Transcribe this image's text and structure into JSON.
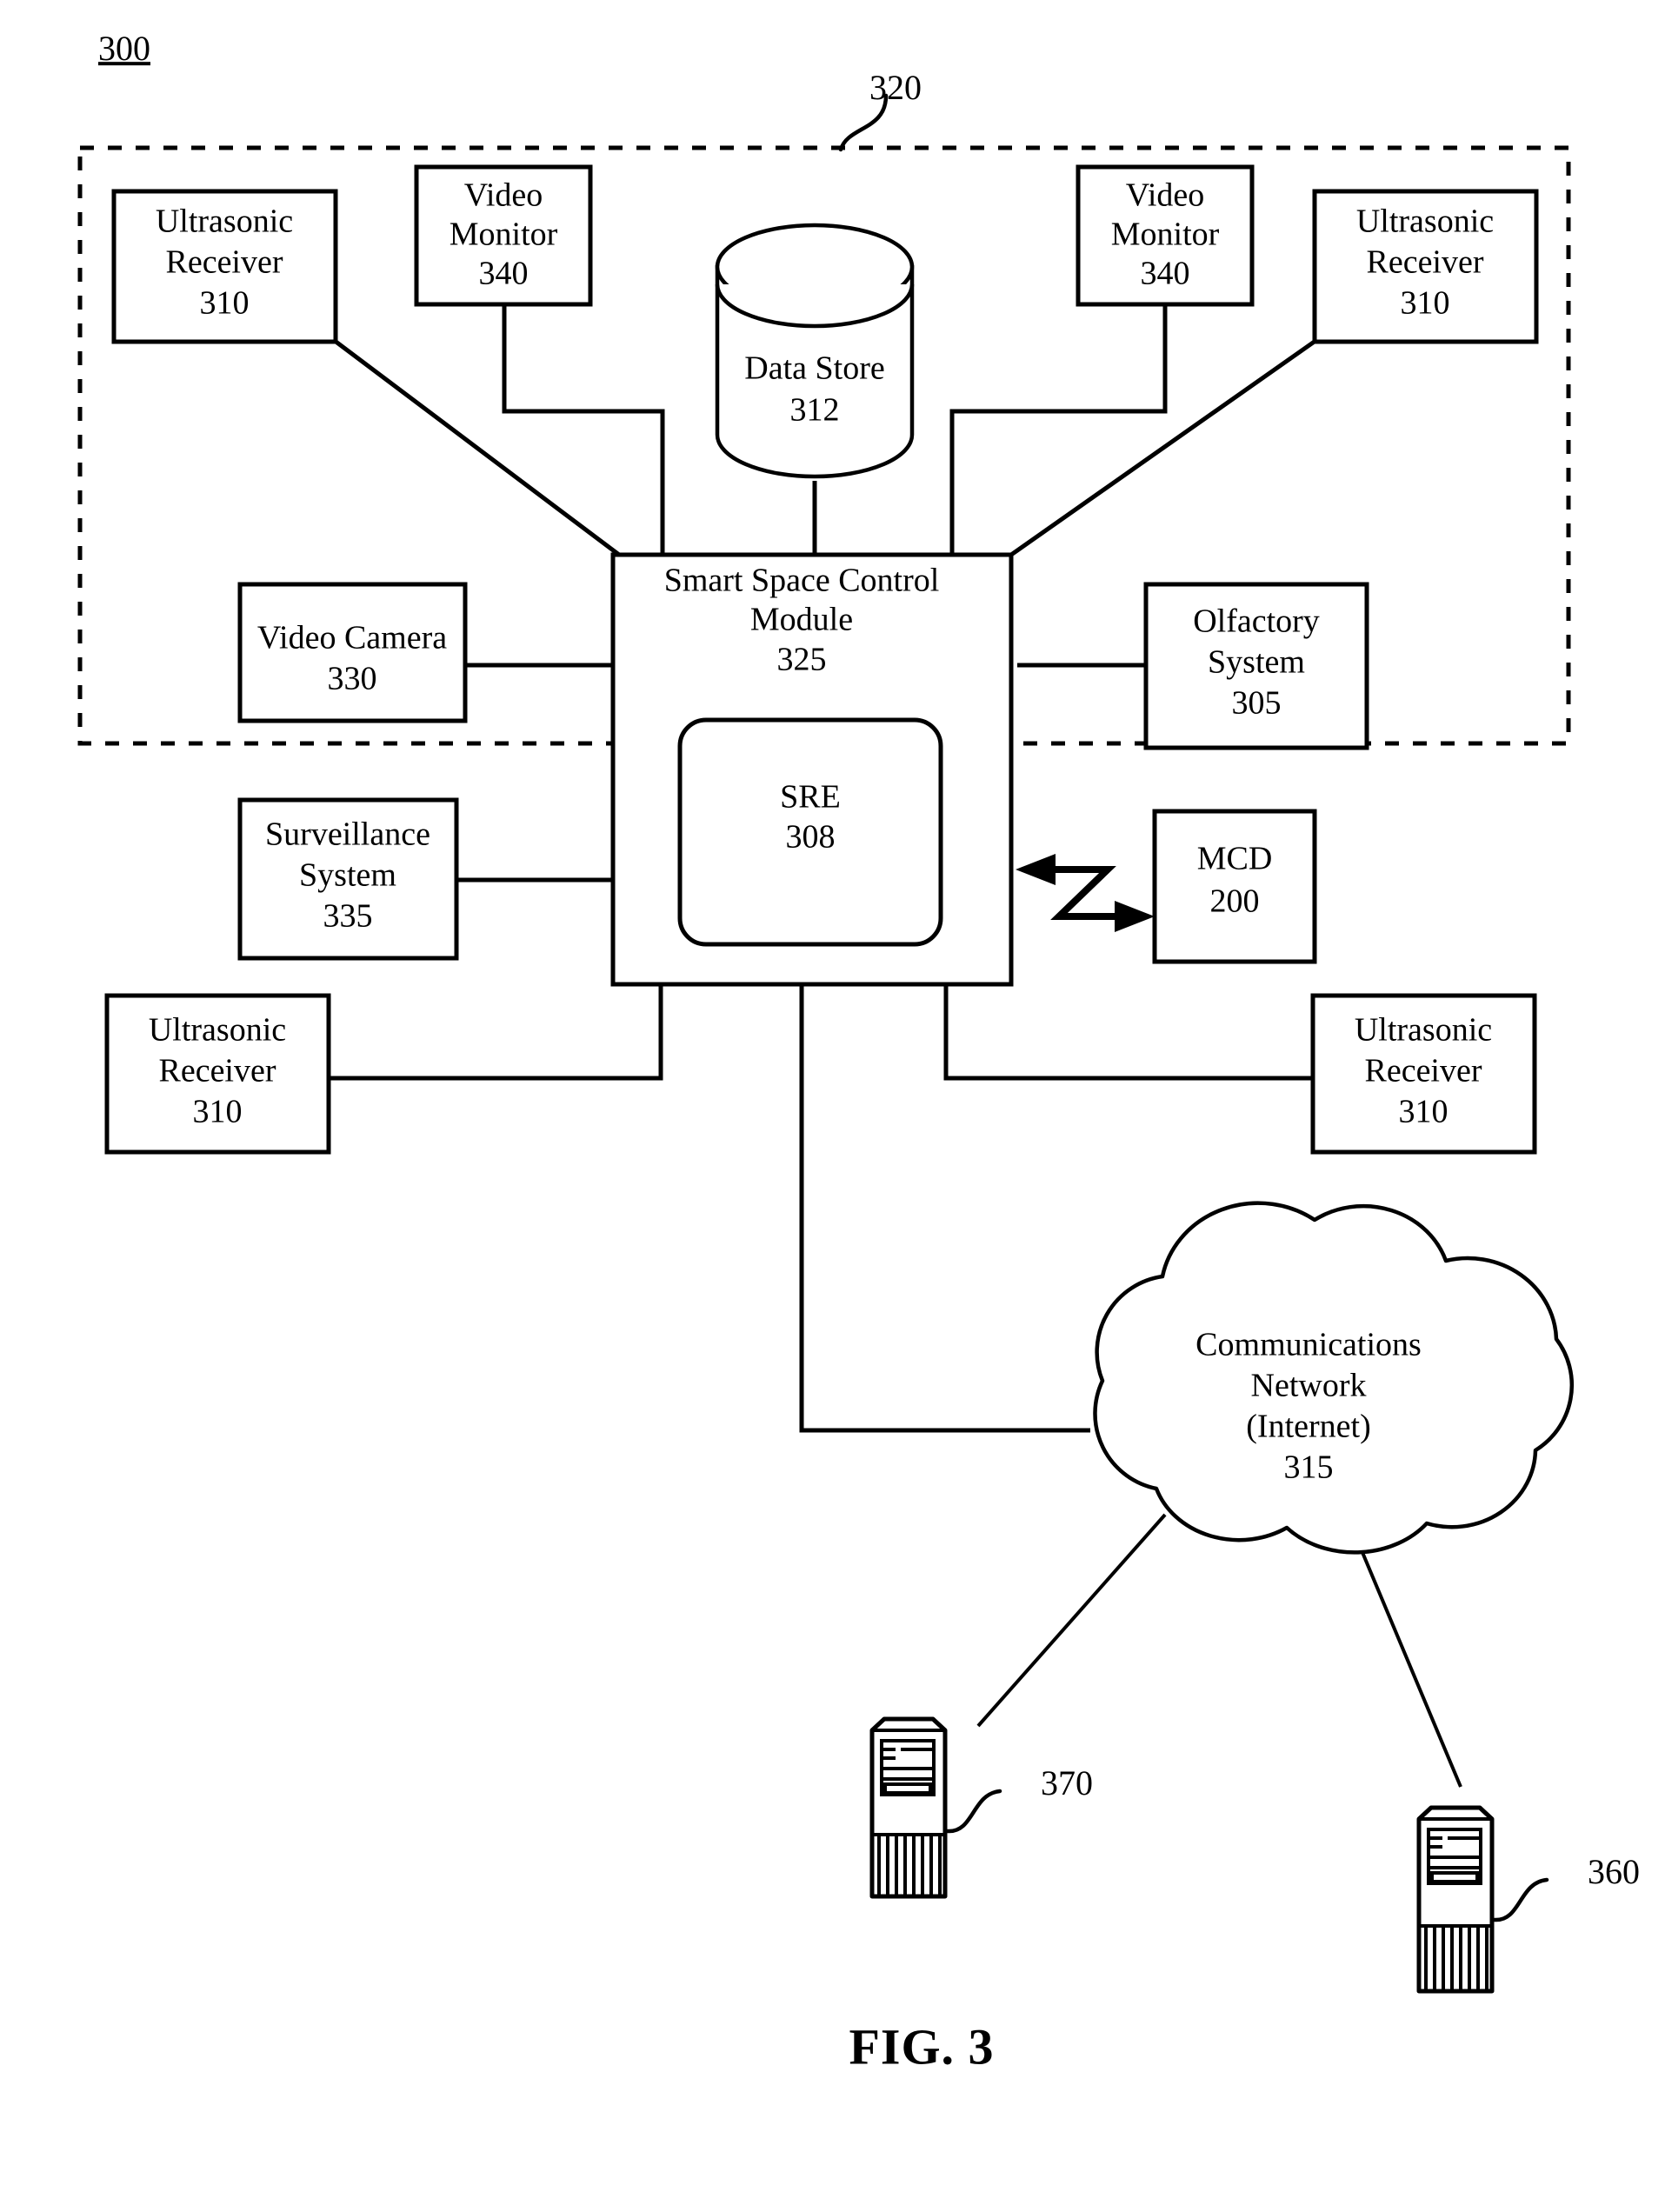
{
  "figure": {
    "number_label": "300",
    "caption": "FIG. 3",
    "enclosure_ref": "320"
  },
  "nodes": {
    "ultrasonic_receiver_tl": {
      "line1": "Ultrasonic",
      "line2": "Receiver",
      "ref": "310"
    },
    "video_monitor_left": {
      "line1": "Video",
      "line2": "Monitor",
      "ref": "340"
    },
    "data_store": {
      "line1": "Data Store",
      "ref": "312"
    },
    "video_monitor_right": {
      "line1": "Video",
      "line2": "Monitor",
      "ref": "340"
    },
    "ultrasonic_receiver_tr": {
      "line1": "Ultrasonic",
      "line2": "Receiver",
      "ref": "310"
    },
    "video_camera": {
      "line1": "Video Camera",
      "ref": "330"
    },
    "control_module": {
      "line1": "Smart Space Control",
      "line2": "Module",
      "ref": "325"
    },
    "sre": {
      "line1": "SRE",
      "ref": "308"
    },
    "olfactory_system": {
      "line1": "Olfactory",
      "line2": "System",
      "ref": "305"
    },
    "surveillance_system": {
      "line1": "Surveillance",
      "line2": "System",
      "ref": "335"
    },
    "mcd": {
      "line1": "MCD",
      "ref": "200"
    },
    "ultrasonic_receiver_bl": {
      "line1": "Ultrasonic",
      "line2": "Receiver",
      "ref": "310"
    },
    "ultrasonic_receiver_br": {
      "line1": "Ultrasonic",
      "line2": "Receiver",
      "ref": "310"
    },
    "network_cloud": {
      "line1": "Communications",
      "line2": "Network",
      "line3": "(Internet)",
      "ref": "315"
    },
    "server_left": {
      "ref": "370"
    },
    "server_right": {
      "ref": "360"
    }
  },
  "colors": {
    "stroke": "#000000",
    "background": "#ffffff"
  }
}
